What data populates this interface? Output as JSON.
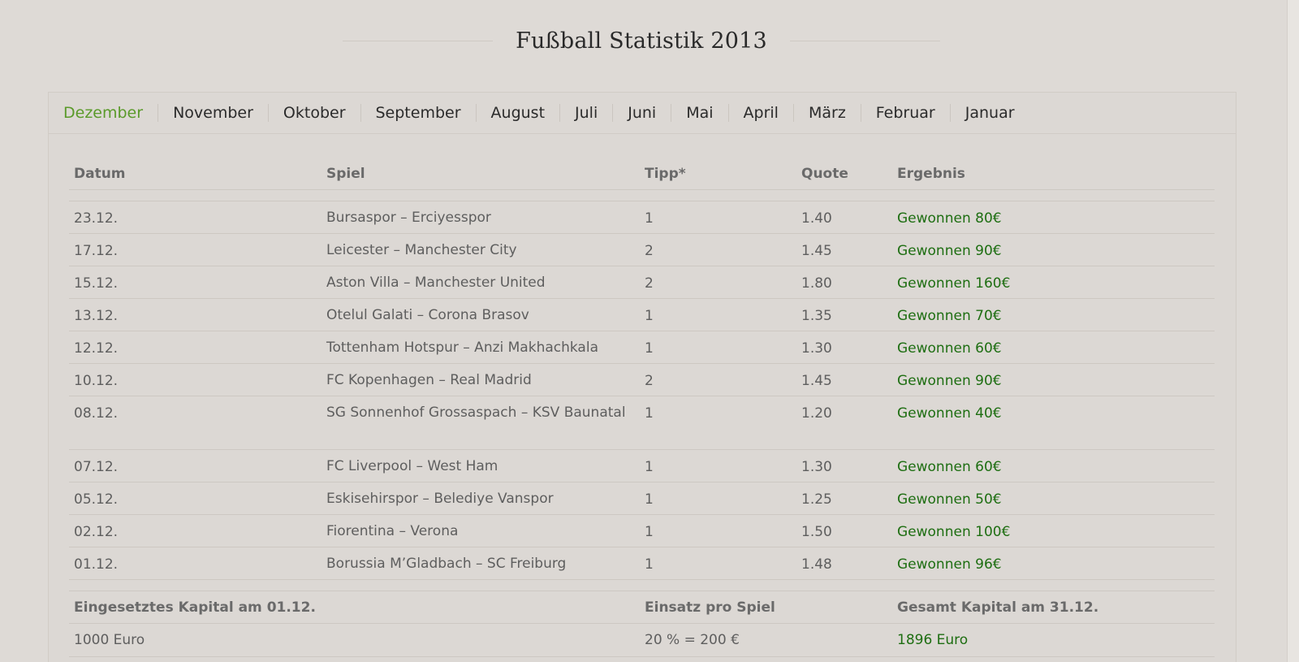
{
  "page": {
    "title": "Fußball Statistik 2013"
  },
  "tabs": [
    {
      "label": "Dezember",
      "active": true
    },
    {
      "label": "November",
      "active": false
    },
    {
      "label": "Oktober",
      "active": false
    },
    {
      "label": "September",
      "active": false
    },
    {
      "label": "August",
      "active": false
    },
    {
      "label": "Juli",
      "active": false
    },
    {
      "label": "Juni",
      "active": false
    },
    {
      "label": "Mai",
      "active": false
    },
    {
      "label": "April",
      "active": false
    },
    {
      "label": "März",
      "active": false
    },
    {
      "label": "Februar",
      "active": false
    },
    {
      "label": "Januar",
      "active": false
    }
  ],
  "table": {
    "headers": {
      "date": "Datum",
      "game": "Spiel",
      "tip": "Tipp*",
      "quote": "Quote",
      "result": "Ergebnis"
    },
    "rows": [
      {
        "date": "23.12.",
        "game": "Bursaspor – Erciyesspor",
        "tip": "1",
        "quote": "1.40",
        "result": "Gewonnen 80€"
      },
      {
        "date": "17.12.",
        "game": "Leicester – Manchester City",
        "tip": "2",
        "quote": "1.45",
        "result": "Gewonnen 90€"
      },
      {
        "date": "15.12.",
        "game": "Aston Villa – Manchester United",
        "tip": "2",
        "quote": "1.80",
        "result": "Gewonnen 160€"
      },
      {
        "date": "13.12.",
        "game": "Otelul Galati – Corona Brasov",
        "tip": "1",
        "quote": "1.35",
        "result": "Gewonnen 70€"
      },
      {
        "date": "12.12.",
        "game": "Tottenham Hotspur – Anzi Makhachkala",
        "tip": "1",
        "quote": "1.30",
        "result": "Gewonnen 60€"
      },
      {
        "date": "10.12.",
        "game": "FC Kopenhagen – Real Madrid",
        "tip": "2",
        "quote": "1.45",
        "result": "Gewonnen 90€"
      },
      {
        "date": "08.12.",
        "game": "SG Sonnenhof Grossaspach – KSV Baunatal",
        "tip": "1",
        "quote": "1.20",
        "result": "Gewonnen 40€"
      },
      {
        "date": "07.12.",
        "game": "FC Liverpool – West Ham",
        "tip": "1",
        "quote": "1.30",
        "result": "Gewonnen 60€"
      },
      {
        "date": "05.12.",
        "game": "Eskisehirspor – Belediye Vanspor",
        "tip": "1",
        "quote": "1.25",
        "result": "Gewonnen 50€"
      },
      {
        "date": "02.12.",
        "game": "Fiorentina – Verona",
        "tip": "1",
        "quote": "1.50",
        "result": "Gewonnen 100€"
      },
      {
        "date": "01.12.",
        "game": "Borussia M’Gladbach – SC Freiburg",
        "tip": "1",
        "quote": "1.48",
        "result": "Gewonnen 96€"
      }
    ]
  },
  "summary": {
    "headers": {
      "capital": "Eingesetztes Kapital am 01.12.",
      "stake": "Einsatz pro Spiel",
      "total": "Gesamt Kapital am 31.12."
    },
    "values": {
      "capital": "1000 Euro",
      "stake": "20 % = 200 €",
      "total": "1896 Euro"
    }
  },
  "colors": {
    "background": "#dedad6",
    "active_tab": "#5a9a2a",
    "result_green": "#1e6e12"
  }
}
